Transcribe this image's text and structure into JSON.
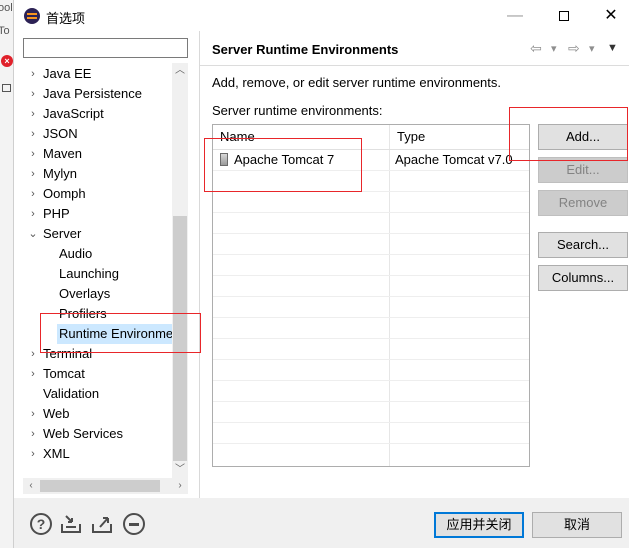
{
  "background_window": {
    "fragments": [
      "ool",
      "To"
    ]
  },
  "window": {
    "title": "首选项",
    "minimize_glyph": "—",
    "close_glyph": "✕"
  },
  "filter": {
    "value": "",
    "placeholder": ""
  },
  "tree": {
    "items": [
      {
        "label": "Java EE",
        "level": 0,
        "expander": "collapsed"
      },
      {
        "label": "Java Persistence",
        "level": 0,
        "expander": "collapsed"
      },
      {
        "label": "JavaScript",
        "level": 0,
        "expander": "collapsed"
      },
      {
        "label": "JSON",
        "level": 0,
        "expander": "collapsed"
      },
      {
        "label": "Maven",
        "level": 0,
        "expander": "collapsed"
      },
      {
        "label": "Mylyn",
        "level": 0,
        "expander": "collapsed"
      },
      {
        "label": "Oomph",
        "level": 0,
        "expander": "collapsed"
      },
      {
        "label": "PHP",
        "level": 0,
        "expander": "collapsed"
      },
      {
        "label": "Server",
        "level": 0,
        "expander": "expanded"
      },
      {
        "label": "Audio",
        "level": 1,
        "expander": "none"
      },
      {
        "label": "Launching",
        "level": 1,
        "expander": "none"
      },
      {
        "label": "Overlays",
        "level": 1,
        "expander": "none"
      },
      {
        "label": "Profilers",
        "level": 1,
        "expander": "none"
      },
      {
        "label": "Runtime Environme",
        "level": 1,
        "expander": "none",
        "selected": true
      },
      {
        "label": "Terminal",
        "level": 0,
        "expander": "collapsed"
      },
      {
        "label": "Tomcat",
        "level": 0,
        "expander": "collapsed"
      },
      {
        "label": "Validation",
        "level": 0,
        "expander": "none"
      },
      {
        "label": "Web",
        "level": 0,
        "expander": "collapsed"
      },
      {
        "label": "Web Services",
        "level": 0,
        "expander": "collapsed"
      },
      {
        "label": "XML",
        "level": 0,
        "expander": "collapsed"
      }
    ]
  },
  "page": {
    "title": "Server Runtime Environments",
    "description": "Add, remove, or edit server runtime environments.",
    "list_label": "Server runtime environments:",
    "nav": {
      "back": "⇦",
      "forward": "⇨",
      "dropdown": "▾",
      "menu": "▼"
    }
  },
  "table": {
    "columns": [
      "Name",
      "Type"
    ],
    "rows": [
      {
        "name": "Apache Tomcat 7",
        "type": "Apache Tomcat v7.0"
      }
    ]
  },
  "buttons": {
    "add": "Add...",
    "edit": "Edit...",
    "remove": "Remove",
    "search": "Search...",
    "columns": "Columns..."
  },
  "footer": {
    "help_glyph": "?",
    "apply_close": "应用并关闭",
    "cancel": "取消"
  },
  "colors": {
    "selection": "#cce8ff",
    "annotation_red": "#e8262a",
    "default_button_border": "#0078d7"
  }
}
